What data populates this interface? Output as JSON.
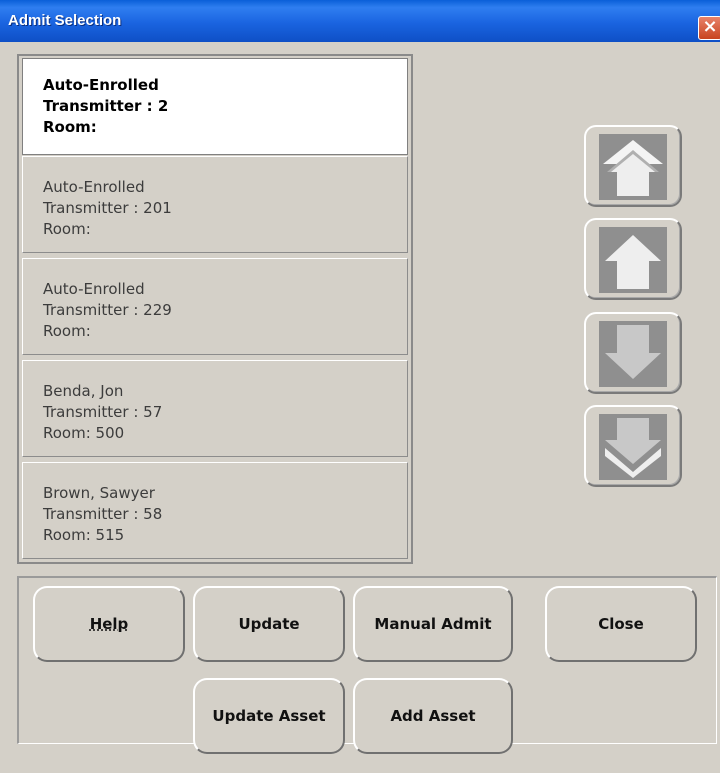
{
  "window": {
    "title": "Admit Selection",
    "close_glyph": "×"
  },
  "list": {
    "items": [
      {
        "name": "Auto-Enrolled",
        "transmitter": "Transmitter : 2",
        "room": "Room:",
        "selected": true
      },
      {
        "name": "Auto-Enrolled",
        "transmitter": "Transmitter : 201",
        "room": "Room:"
      },
      {
        "name": "Auto-Enrolled",
        "transmitter": "Transmitter : 229",
        "room": "Room:"
      },
      {
        "name": "Benda, Jon",
        "transmitter": "Transmitter : 57",
        "room": "Room: 500"
      },
      {
        "name": "Brown, Sawyer",
        "transmitter": "Transmitter : 58",
        "room": "Room: 515"
      }
    ]
  },
  "nav_icons": [
    "scroll-to-top-icon",
    "scroll-up-icon",
    "scroll-down-icon",
    "scroll-to-bottom-icon"
  ],
  "buttons": {
    "help": "Help",
    "update": "Update",
    "manual_admit": "Manual Admit",
    "close": "Close",
    "update_asset": "Update Asset",
    "add_asset": "Add Asset"
  },
  "colors": {
    "titlebar": "#1a64e0",
    "window_bg": "#d4d0c8",
    "selected_bg": "#ffffff",
    "arrow_fill": "#a8a8a8"
  }
}
